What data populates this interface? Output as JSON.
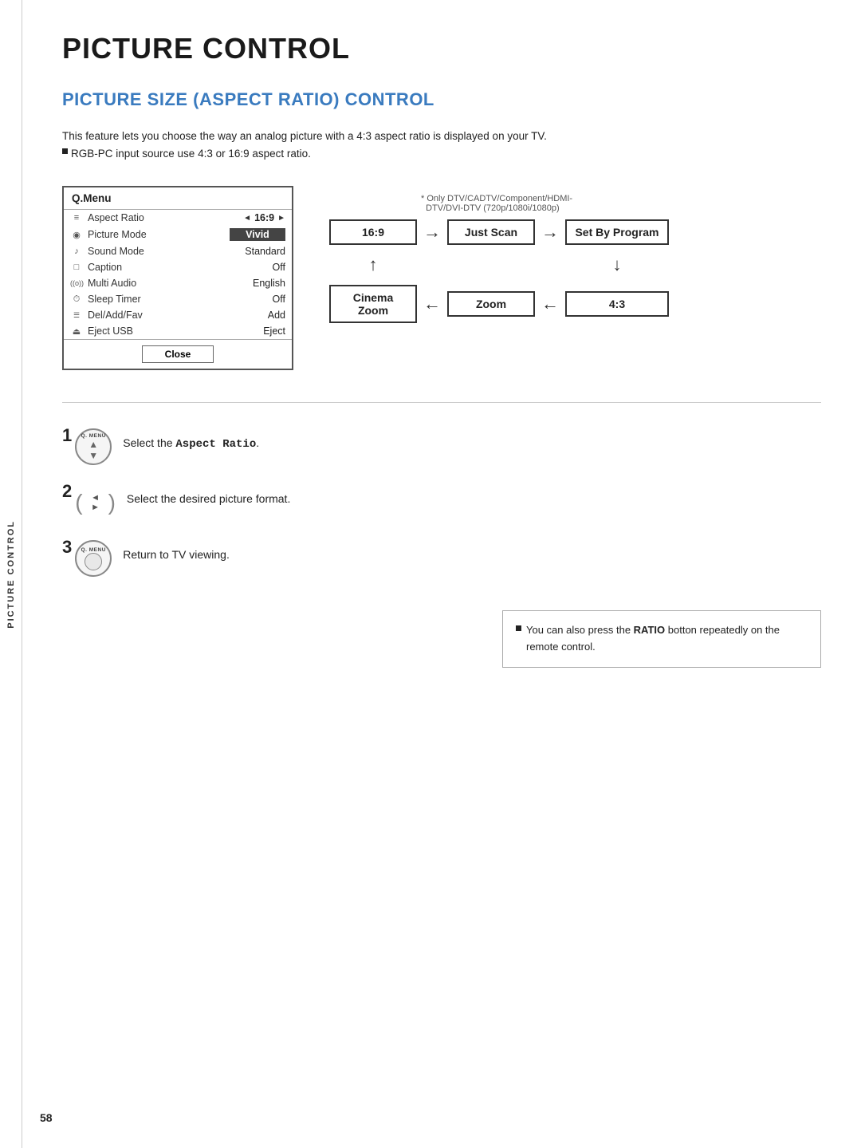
{
  "side_label": "PICTURE CONTROL",
  "page_title": "PICTURE CONTROL",
  "section_title": "PICTURE SIZE (ASPECT RATIO) CONTROL",
  "intro": {
    "line1": "This feature lets you choose the way an analog picture with a 4:3 aspect ratio is displayed on your TV.",
    "bullet": "RGB-PC input source use 4:3 or 16:9 aspect ratio."
  },
  "qmenu": {
    "title": "Q.Menu",
    "rows": [
      {
        "icon": "≡",
        "label": "Aspect Ratio",
        "value": "16:9",
        "has_arrows": true,
        "highlighted": false
      },
      {
        "icon": "◉",
        "label": "Picture Mode",
        "value": "Vivid",
        "has_arrows": false,
        "highlighted": true
      },
      {
        "icon": "♪",
        "label": "Sound Mode",
        "value": "Standard",
        "has_arrows": false,
        "highlighted": false
      },
      {
        "icon": "□",
        "label": "Caption",
        "value": "Off",
        "has_arrows": false,
        "highlighted": false
      },
      {
        "icon": "((o))",
        "label": "Multi Audio",
        "value": "English",
        "has_arrows": false,
        "highlighted": false
      },
      {
        "icon": "⏱",
        "label": "Sleep Timer",
        "value": "Off",
        "has_arrows": false,
        "highlighted": false
      },
      {
        "icon": "☰",
        "label": "Del/Add/Fav",
        "value": "Add",
        "has_arrows": false,
        "highlighted": false
      },
      {
        "icon": "⏏",
        "label": "Eject USB",
        "value": "Eject",
        "has_arrows": false,
        "highlighted": false
      }
    ],
    "close_button": "Close"
  },
  "ratio_note": "* Only DTV/CADTV/Component/HDMI-\n  DTV/DVI-DTV (720p/1080i/1080p)",
  "ratio_flow": {
    "boxes": [
      "16:9",
      "Just Scan",
      "Set By  Program",
      "Cinema Zoom",
      "Zoom",
      "4:3"
    ]
  },
  "steps": [
    {
      "num": "1",
      "icon_type": "qmenu",
      "text": "Select the ",
      "text_bold": "Aspect Ratio",
      "text_after": "."
    },
    {
      "num": "2",
      "icon_type": "nav",
      "text": "Select the desired picture format.",
      "text_bold": "",
      "text_after": ""
    },
    {
      "num": "3",
      "icon_type": "qmenu",
      "text": "Return to TV viewing.",
      "text_bold": "",
      "text_after": ""
    }
  ],
  "note": {
    "bullet": "You can also press the ",
    "bold": "RATIO",
    "after": " botton repeatedly on the remote control."
  },
  "page_number": "58"
}
